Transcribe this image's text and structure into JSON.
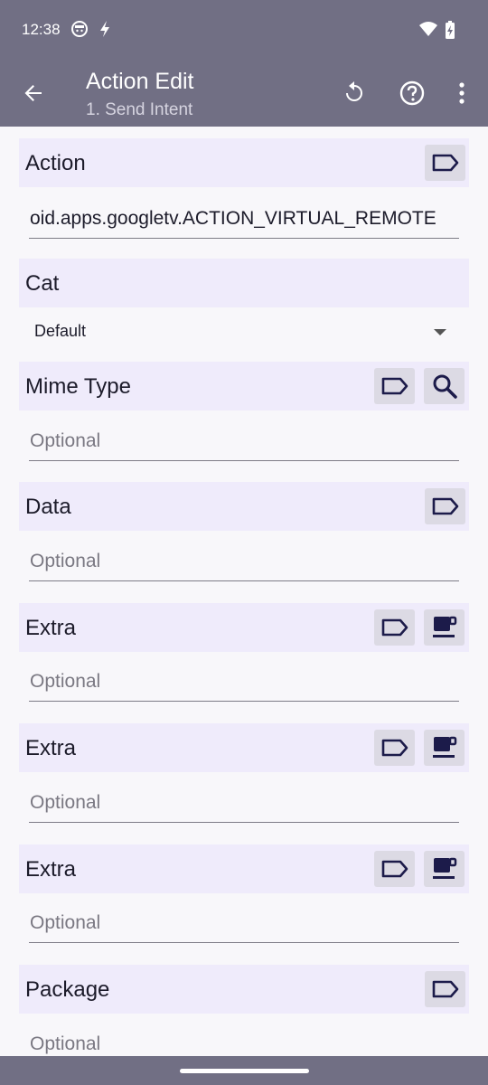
{
  "status_bar": {
    "time": "12:38",
    "icons": [
      "face-notification-icon",
      "flash-icon",
      "wifi-icon",
      "battery-charging-icon"
    ]
  },
  "app_bar": {
    "title": "Action Edit",
    "subtitle": "1. Send Intent",
    "actions": [
      "back-arrow-icon",
      "reset-icon",
      "help-icon",
      "more-vert-icon"
    ]
  },
  "sections": {
    "action": {
      "label": "Action",
      "value": "oid.apps.googletv.ACTION_VIRTUAL_REMOTE"
    },
    "cat": {
      "label": "Cat",
      "selected": "Default"
    },
    "mime_type": {
      "label": "Mime Type",
      "placeholder": "Optional"
    },
    "data": {
      "label": "Data",
      "placeholder": "Optional"
    },
    "extra1": {
      "label": "Extra",
      "placeholder": "Optional"
    },
    "extra2": {
      "label": "Extra",
      "placeholder": "Optional"
    },
    "extra3": {
      "label": "Extra",
      "placeholder": "Optional"
    },
    "package": {
      "label": "Package",
      "placeholder": "Optional"
    }
  },
  "colors": {
    "app_bar": "#716f84",
    "section_header": "#efebfb",
    "icon_button": "#dcdae4",
    "icon_fg": "#1c1b4a"
  }
}
